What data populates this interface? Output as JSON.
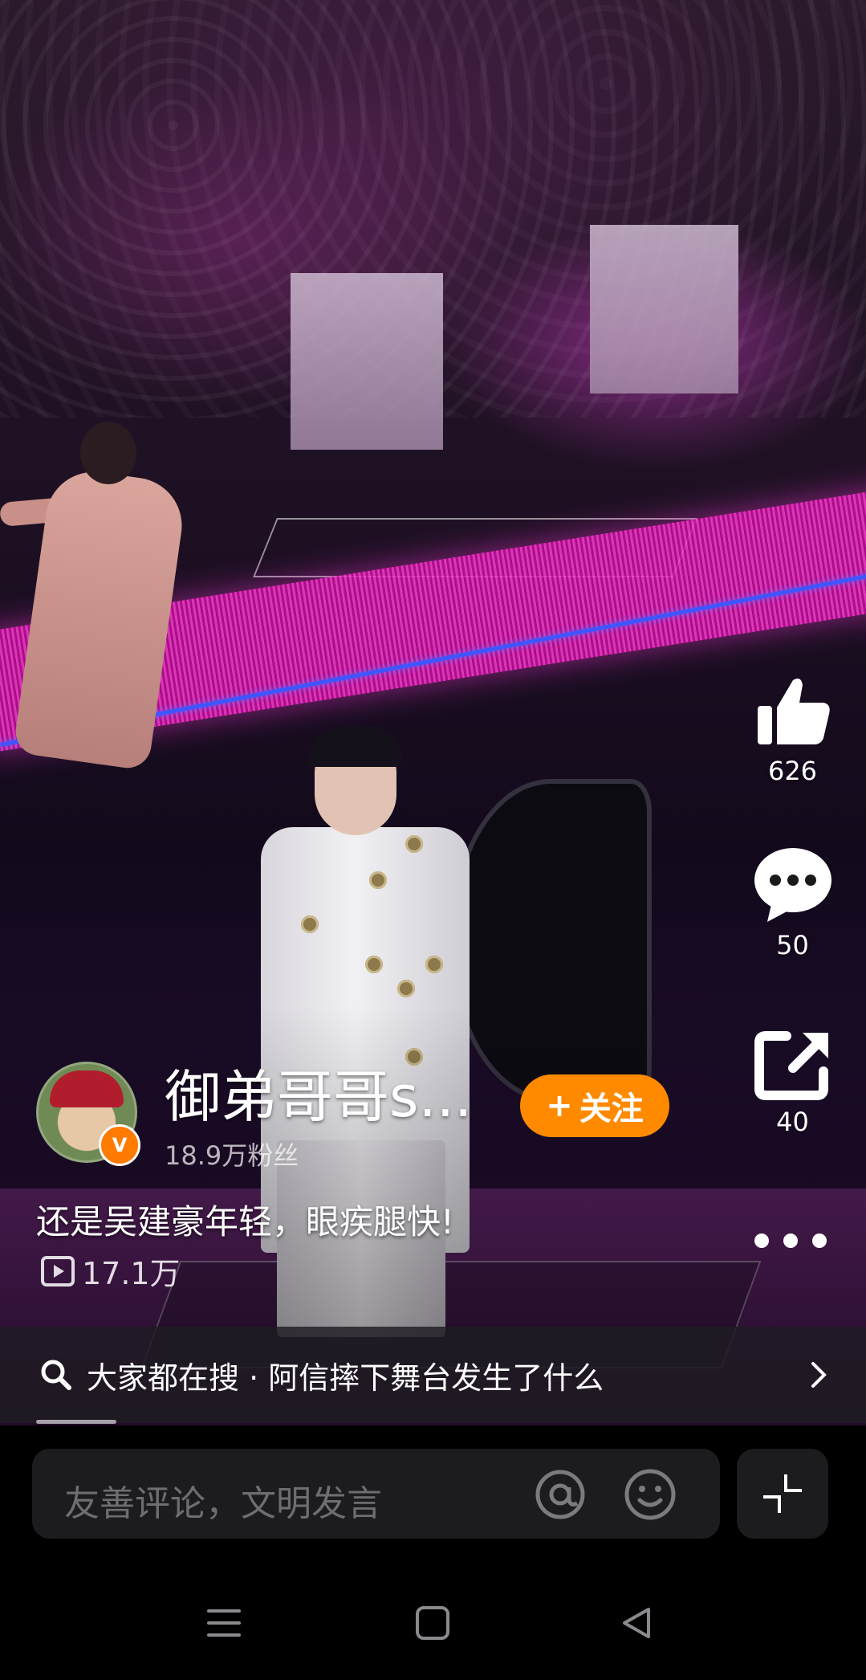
{
  "video": {
    "scene": "concert-stage"
  },
  "actions": {
    "like_count": "626",
    "comment_count": "50",
    "share_count": "40",
    "more_icon": "more-horizontal-icon"
  },
  "author": {
    "name": "御弟哥哥s...",
    "fans": "18.9万粉丝",
    "verified_mark": "V",
    "follow_label": "关注",
    "follow_plus": "+"
  },
  "post": {
    "caption": "还是吴建豪年轻，眼疾腿快!",
    "views": "17.1万"
  },
  "search_banner": {
    "text": "大家都在搜 · 阿信摔下舞台发生了什么"
  },
  "comment": {
    "placeholder": "友善评论，文明发言"
  },
  "colors": {
    "accent": "#ff8a00",
    "input_bg": "#1c1c1e",
    "background": "#000000"
  }
}
